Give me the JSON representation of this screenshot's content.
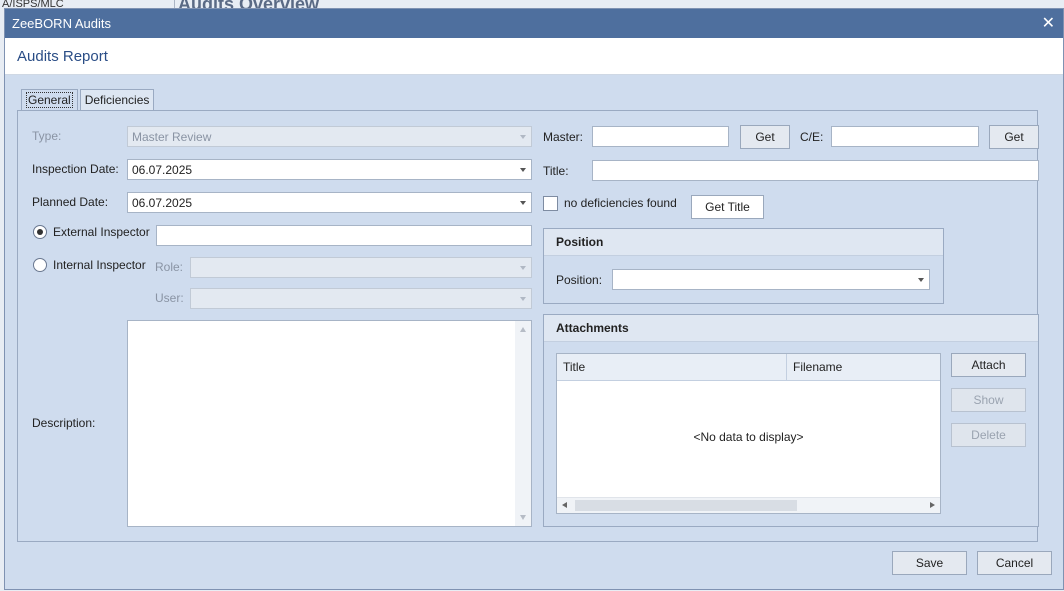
{
  "background": {
    "left_text": "A/ISPS/MLC",
    "title": "Audits Overview"
  },
  "window": {
    "title": "ZeeBORN Audits",
    "close_glyph": "✕"
  },
  "header": {
    "title": "Audits Report"
  },
  "tabs": [
    {
      "label": "General",
      "active": true
    },
    {
      "label": "Deficiencies",
      "active": false
    }
  ],
  "general": {
    "type_label": "Type:",
    "type_value": "Master Review",
    "inspection_date_label": "Inspection Date:",
    "inspection_date_value": "06.07.2025",
    "planned_date_label": "Planned Date:",
    "planned_date_value": "06.07.2025",
    "external_inspector_label": "External Inspector",
    "external_inspector_value": "",
    "internal_inspector_label": "Internal Inspector",
    "role_label": "Role:",
    "role_value": "",
    "user_label": "User:",
    "user_value": "",
    "description_label": "Description:",
    "description_value": "",
    "master_label": "Master:",
    "master_value": "",
    "master_get_button": "Get",
    "ce_label": "C/E:",
    "ce_value": "",
    "ce_get_button": "Get",
    "title_label": "Title:",
    "title_value": "",
    "no_deficiencies_label": "no deficiencies found",
    "get_title_button": "Get Title"
  },
  "position_group": {
    "title": "Position",
    "position_label": "Position:",
    "position_value": ""
  },
  "attachments_group": {
    "title": "Attachments",
    "columns": [
      "Title",
      "Filename"
    ],
    "empty_text": "<No data to display>",
    "attach_button": "Attach",
    "show_button": "Show",
    "delete_button": "Delete"
  },
  "footer": {
    "save_button": "Save",
    "cancel_button": "Cancel"
  }
}
